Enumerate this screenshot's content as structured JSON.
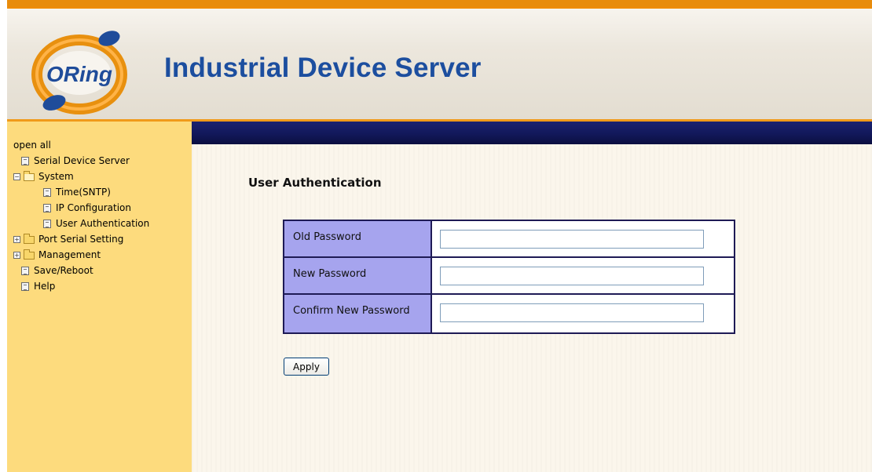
{
  "header": {
    "logo_text": "ORing",
    "title": "Industrial Device Server"
  },
  "sidebar": {
    "open_all": "open all",
    "items": [
      {
        "label": "Serial Device Server",
        "icon": "document-icon"
      },
      {
        "label": "System",
        "icon": "open-folder-icon",
        "expander": "⊟"
      },
      {
        "label": "Time(SNTP)",
        "icon": "document-icon"
      },
      {
        "label": "IP Configuration",
        "icon": "document-icon"
      },
      {
        "label": "User Authentication",
        "icon": "document-icon"
      },
      {
        "label": "Port Serial Setting",
        "icon": "folder-icon",
        "expander": "⊞"
      },
      {
        "label": "Management",
        "icon": "folder-icon",
        "expander": "⊞"
      },
      {
        "label": "Save/Reboot",
        "icon": "document-icon"
      },
      {
        "label": "Help",
        "icon": "document-icon"
      }
    ]
  },
  "main": {
    "page_title": "User Authentication",
    "form": {
      "rows": [
        {
          "label": "Old Password",
          "value": ""
        },
        {
          "label": "New Password",
          "value": ""
        },
        {
          "label": "Confirm New Password",
          "value": ""
        }
      ]
    },
    "apply_label": "Apply"
  },
  "colors": {
    "header_accent": "#e88c0c",
    "title_blue": "#1c4e9f",
    "sidebar_bg": "#fddb7d",
    "navbar": "#12185a",
    "label_cell": "#a6a4ee"
  }
}
